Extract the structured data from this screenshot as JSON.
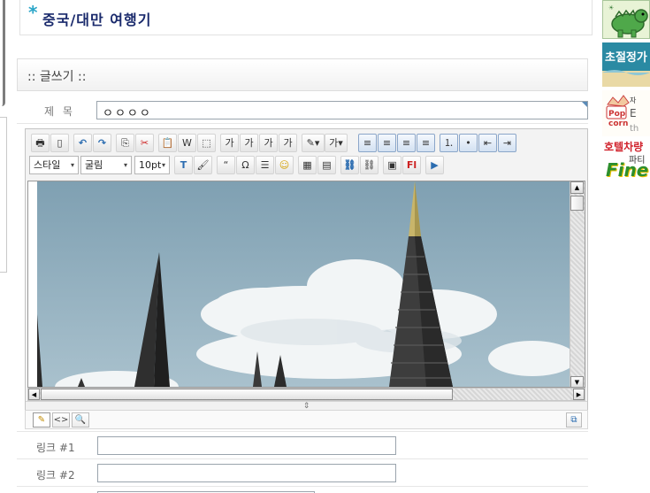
{
  "page": {
    "title_star": "*",
    "title": "중국/대만 여행기"
  },
  "section": {
    "heading": ":: 글쓰기 ::"
  },
  "subject": {
    "label": "제 목",
    "value": "ㅇㅇㅇㅇ"
  },
  "toolbar1": [
    {
      "name": "print-icon",
      "glyph": "🖶"
    },
    {
      "name": "new-page-icon",
      "glyph": "▯"
    },
    {
      "name": "undo-icon",
      "glyph": "↶"
    },
    {
      "name": "redo-icon",
      "glyph": "↷"
    },
    {
      "name": "copy-icon",
      "glyph": "⎘"
    },
    {
      "name": "cut-icon",
      "glyph": "✂"
    },
    {
      "name": "paste-icon",
      "glyph": "📋"
    },
    {
      "name": "paste-word-icon",
      "glyph": "W"
    },
    {
      "name": "select-all-icon",
      "glyph": "⬚"
    },
    {
      "name": "bold-icon",
      "glyph": "가"
    },
    {
      "name": "italic-icon",
      "glyph": "가"
    },
    {
      "name": "underline-icon",
      "glyph": "가"
    },
    {
      "name": "strikethrough-icon",
      "glyph": "가"
    },
    {
      "name": "highlight-color-icon",
      "glyph": "✎▾"
    },
    {
      "name": "font-color-icon",
      "glyph": "가▾"
    },
    {
      "name": "align-left-icon",
      "glyph": "≡"
    },
    {
      "name": "align-center-icon",
      "glyph": "≡"
    },
    {
      "name": "align-right-icon",
      "glyph": "≡"
    },
    {
      "name": "align-justify-icon",
      "glyph": "≡"
    },
    {
      "name": "ordered-list-icon",
      "glyph": "⒈"
    },
    {
      "name": "unordered-list-icon",
      "glyph": "•"
    },
    {
      "name": "outdent-icon",
      "glyph": "⇤"
    },
    {
      "name": "indent-icon",
      "glyph": "⇥"
    }
  ],
  "toolbar2": {
    "style_select": "스타일",
    "font_select": "굴림",
    "size_select": "10pt",
    "buttons": [
      {
        "name": "spellcheck-icon",
        "glyph": "T"
      },
      {
        "name": "clear-format-icon",
        "glyph": "🖌"
      },
      {
        "name": "quote-icon",
        "glyph": "“"
      },
      {
        "name": "special-char-icon",
        "glyph": "Ω"
      },
      {
        "name": "horizontal-rule-icon",
        "glyph": "☰"
      },
      {
        "name": "emoticon-icon",
        "glyph": "☺"
      },
      {
        "name": "table-icon",
        "glyph": "▦"
      },
      {
        "name": "edit-table-icon",
        "glyph": "▤"
      },
      {
        "name": "link-icon",
        "glyph": "⛓"
      },
      {
        "name": "unlink-icon",
        "glyph": "⛓"
      },
      {
        "name": "image-icon",
        "glyph": "▣"
      },
      {
        "name": "flash-icon",
        "glyph": "Fl"
      },
      {
        "name": "media-play-icon",
        "glyph": "▶"
      }
    ]
  },
  "mode_bar": [
    {
      "name": "edit-mode-icon",
      "glyph": "✎"
    },
    {
      "name": "html-mode-icon",
      "glyph": "<>"
    },
    {
      "name": "preview-mode-icon",
      "glyph": "🔍"
    }
  ],
  "links": [
    {
      "label": "링크 #1",
      "value": ""
    },
    {
      "label": "링크 #2",
      "value": ""
    }
  ],
  "ads": {
    "ad2_text": "초절정가",
    "ad4_text": "호텔차량",
    "ad4_sub": "파티",
    "ad4_brand": "Fine"
  },
  "colors": {
    "title": "#1a2a6c",
    "star": "#2aa5c8",
    "sky": "#8fb0c4"
  }
}
